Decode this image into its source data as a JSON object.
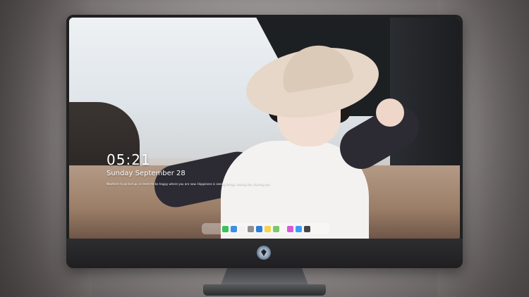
{
  "lockscreen": {
    "time": "05:21",
    "date": "Sunday September  28",
    "quote": "Nowhere to go but up, so learn to be happy where you are now. Happiness is seeing things, feeling life, sharing you"
  },
  "dock": {
    "apps": [
      {
        "name": "messages-icon",
        "color": "#39c15a"
      },
      {
        "name": "finder-icon",
        "color": "#3b8ee6"
      },
      {
        "name": "clock-icon",
        "color": "#f2f2f2"
      },
      {
        "name": "settings-icon",
        "color": "#8e8e93"
      },
      {
        "name": "media-icon",
        "color": "#2b7fd9"
      },
      {
        "name": "notes-icon",
        "color": "#f4d54a"
      },
      {
        "name": "photos-icon",
        "color": "#7bc86c"
      },
      {
        "name": "music-icon",
        "color": "#d65ad8"
      },
      {
        "name": "appstore-icon",
        "color": "#3a9df5"
      },
      {
        "name": "camera-icon",
        "color": "#454548"
      }
    ]
  },
  "colors": {
    "bezel": "#202021",
    "dock_bg": "rgba(255,255,255,0.35)"
  }
}
